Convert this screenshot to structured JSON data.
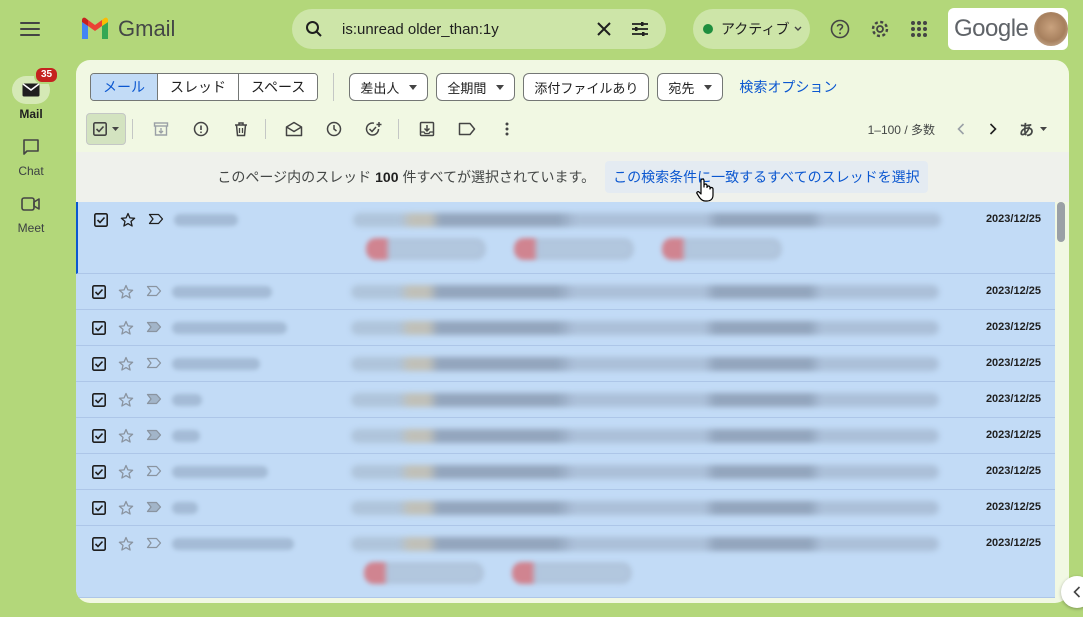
{
  "app": {
    "logo_text": "Gmail",
    "brand": "Google"
  },
  "colors": {
    "background": "#b3d77a",
    "selected_row": "#c2dbf6",
    "accent": "#0b57d0",
    "badge": "#c5221f",
    "status_dot": "#1e8e3e"
  },
  "rail": {
    "items": [
      {
        "label": "Mail",
        "icon": "mail-icon",
        "badge": "35",
        "active": true
      },
      {
        "label": "Chat",
        "icon": "chat-icon",
        "active": false
      },
      {
        "label": "Meet",
        "icon": "meet-icon",
        "active": false
      }
    ]
  },
  "search": {
    "query": "is:unread older_than:1y"
  },
  "status": {
    "label": "アクティブ"
  },
  "filters": {
    "segments": [
      "メール",
      "スレッド",
      "スペース"
    ],
    "chips": [
      {
        "label": "差出人",
        "dropdown": true
      },
      {
        "label": "全期間",
        "dropdown": true
      },
      {
        "label": "添付ファイルあり",
        "dropdown": false
      },
      {
        "label": "宛先",
        "dropdown": true
      }
    ],
    "advanced": "検索オプション"
  },
  "pager": {
    "range": "1–100 / 多数",
    "lang": "あ"
  },
  "banner": {
    "prefix": "このページ内のスレッド",
    "count": "100",
    "suffix": "件すべてが選択されています。",
    "link": "この検索条件に一致するすべてのスレッドを選択"
  },
  "rows": [
    {
      "date": "2023/12/25",
      "attachments": 3,
      "important": false
    },
    {
      "date": "2023/12/25",
      "attachments": 0,
      "important": false
    },
    {
      "date": "2023/12/25",
      "attachments": 0,
      "important": true
    },
    {
      "date": "2023/12/25",
      "attachments": 0,
      "important": false
    },
    {
      "date": "2023/12/25",
      "attachments": 0,
      "important": true
    },
    {
      "date": "2023/12/25",
      "attachments": 0,
      "important": true
    },
    {
      "date": "2023/12/25",
      "attachments": 0,
      "important": false
    },
    {
      "date": "2023/12/25",
      "attachments": 0,
      "important": true
    },
    {
      "date": "2023/12/25",
      "attachments": 2,
      "important": false
    }
  ]
}
